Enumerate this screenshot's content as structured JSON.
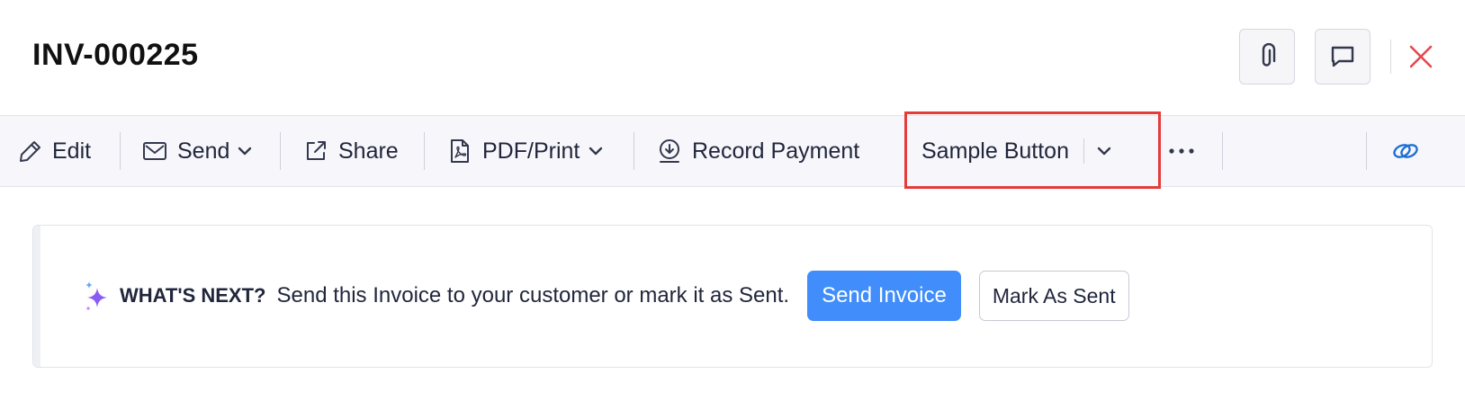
{
  "header": {
    "title": "INV-000225"
  },
  "toolbar": {
    "edit_label": "Edit",
    "send_label": "Send",
    "share_label": "Share",
    "pdf_print_label": "PDF/Print",
    "record_payment_label": "Record Payment",
    "sample_button_label": "Sample Button"
  },
  "whats_next": {
    "label": "WHAT'S NEXT?",
    "message": "Send this Invoice to your customer or mark it as Sent.",
    "send_invoice_label": "Send Invoice",
    "mark_as_sent_label": "Mark As Sent"
  },
  "colors": {
    "primary": "#408dfb",
    "close": "#e5484d",
    "highlight": "#e53b3b",
    "sparkle": "#8a5cf6",
    "integration_link": "#1f6fd6"
  },
  "icons": [
    "paperclip-icon",
    "comment-icon",
    "close-icon",
    "pencil-icon",
    "envelope-icon",
    "chevron-down-icon",
    "share-icon",
    "pdf-icon",
    "download-circle-icon",
    "more-icon",
    "link-icon",
    "sparkle-icon"
  ]
}
